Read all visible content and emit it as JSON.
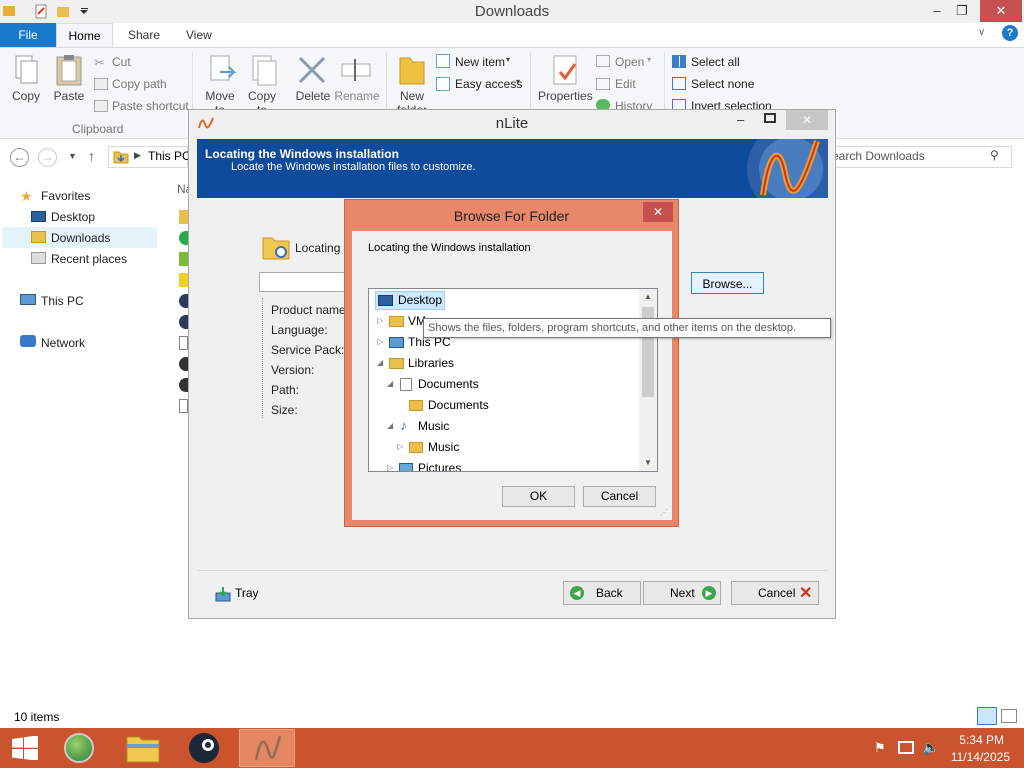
{
  "explorer": {
    "title": "Downloads",
    "tabs": {
      "file": "File",
      "home": "Home",
      "share": "Share",
      "view": "View"
    },
    "ribbon": {
      "copy": "Copy",
      "paste": "Paste",
      "cut": "Cut",
      "copy_path": "Copy path",
      "paste_shortcut": "Paste shortcut",
      "clipboard": "Clipboard",
      "move_to": "Move to",
      "copy_to": "Copy to",
      "delete": "Delete",
      "rename": "Rename",
      "new_folder": "New folder",
      "new_item": "New item",
      "easy_access": "Easy access",
      "properties": "Properties",
      "open": "Open",
      "edit": "Edit",
      "history": "History",
      "select_all": "Select all",
      "select_none": "Select none",
      "invert_selection": "Invert selection"
    },
    "address": "This PC",
    "search_placeholder": "Search Downloads",
    "column_header": "Na",
    "nav": {
      "favorites": "Favorites",
      "desktop": "Desktop",
      "downloads": "Downloads",
      "recent": "Recent places",
      "this_pc": "This PC",
      "network": "Network"
    },
    "status": "10 items"
  },
  "nlite": {
    "title": "nLite",
    "header_title": "Locating the Windows installation",
    "header_subtitle": "Locate the Windows installation files to customize.",
    "locating_label": "Locating th",
    "browse_button": "Browse...",
    "fields": {
      "product_name": "Product name:",
      "language": "Language:",
      "service_pack": "Service Pack:",
      "version": "Version:",
      "path": "Path:",
      "size": "Size:"
    },
    "tray": "Tray",
    "back": "Back",
    "next": "Next",
    "cancel": "Cancel"
  },
  "browse_dialog": {
    "title": "Browse For Folder",
    "close": "✕",
    "description": "Locating the Windows installation",
    "tree": [
      {
        "label": "Desktop",
        "selected": true
      },
      {
        "label": "VM"
      },
      {
        "label": "This PC"
      },
      {
        "label": "Libraries"
      },
      {
        "label": "Documents"
      },
      {
        "label": "Documents"
      },
      {
        "label": "Music"
      },
      {
        "label": "Music"
      },
      {
        "label": "Pictures"
      }
    ],
    "ok": "OK",
    "cancel": "Cancel"
  },
  "tooltip": "Shows the files, folders, program shortcuts, and other items on the desktop.",
  "taskbar": {
    "time": "5:34 PM",
    "date": "11/14/2025"
  }
}
